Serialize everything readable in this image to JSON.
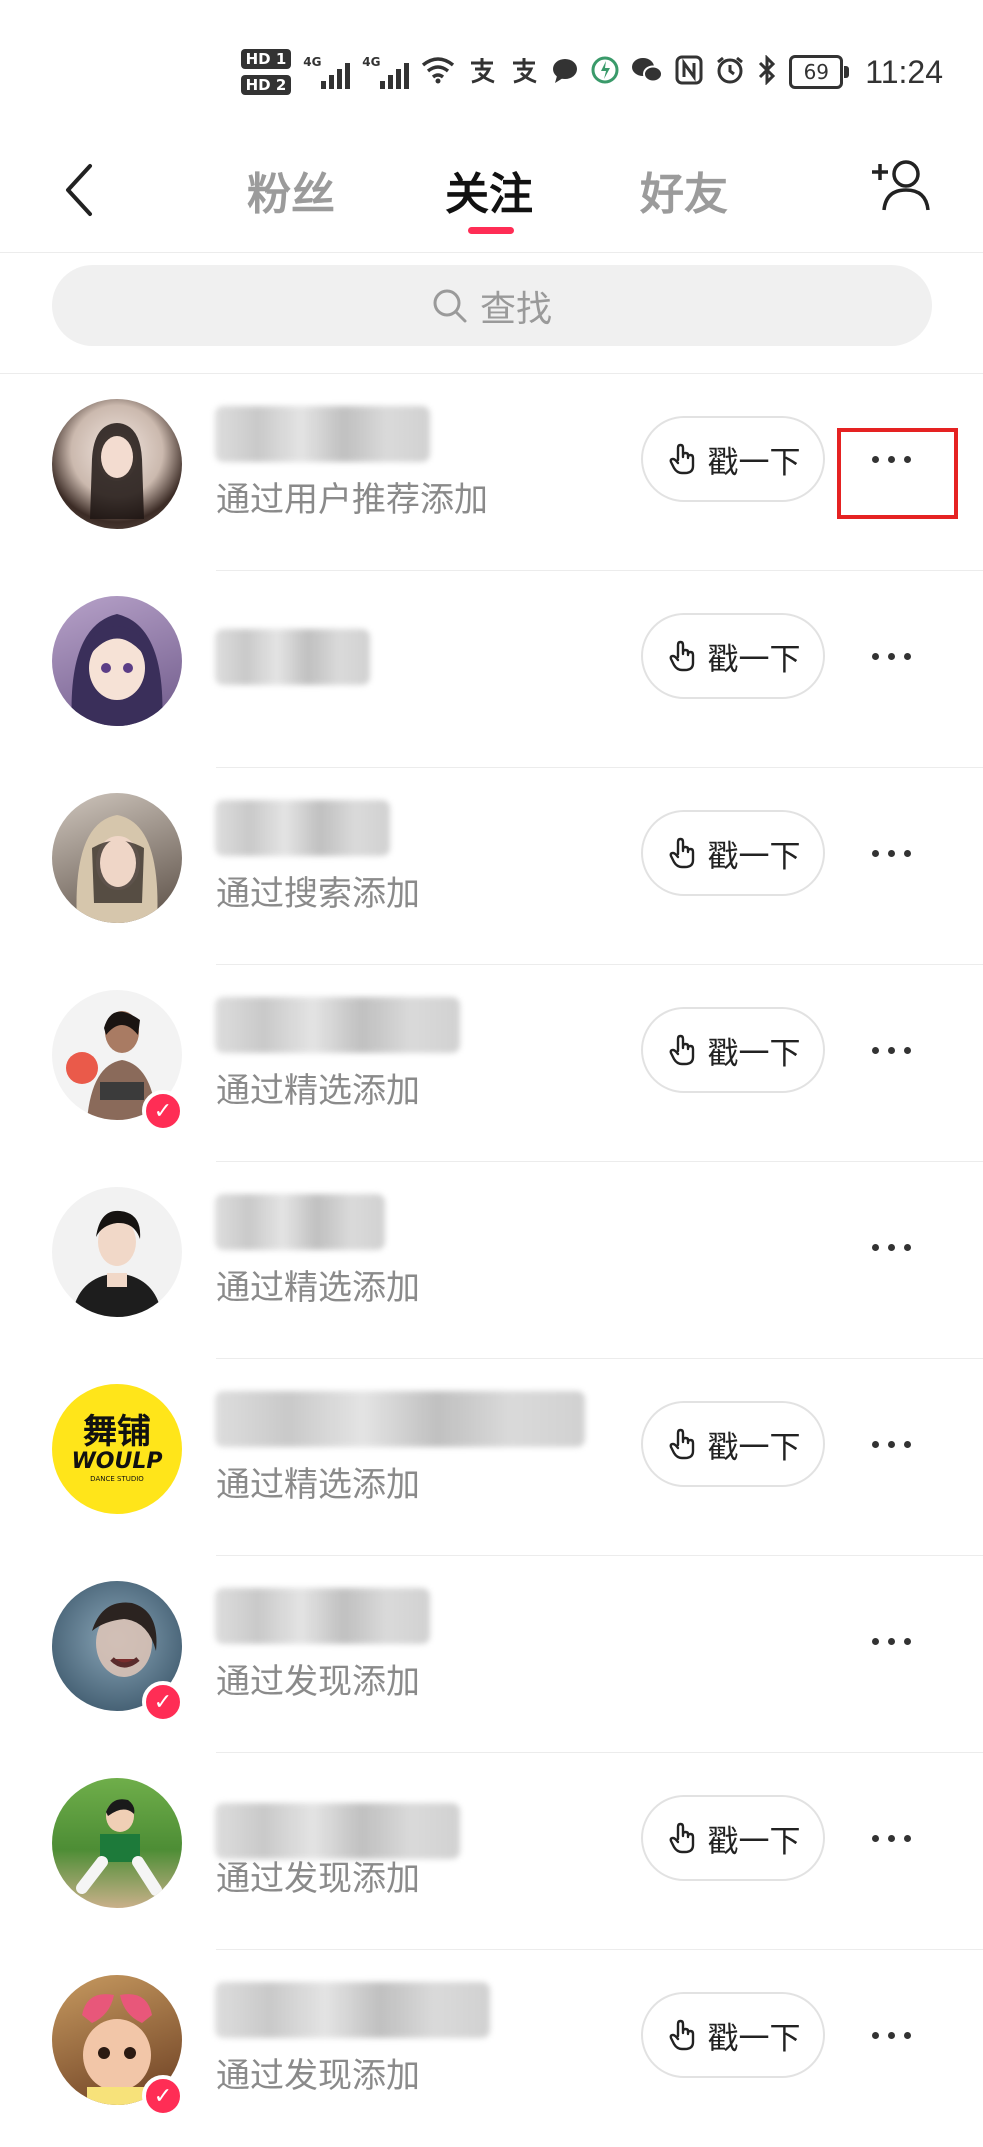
{
  "status_bar": {
    "time": "11:24",
    "battery": "69",
    "hd1": "HD 1",
    "hd2": "HD 2",
    "net1": "4G",
    "net2": "4G"
  },
  "nav": {
    "tabs": [
      {
        "label": "粉丝"
      },
      {
        "label": "关注"
      },
      {
        "label": "好友"
      }
    ],
    "active_tab": "关注"
  },
  "search": {
    "placeholder": "查找"
  },
  "poke_label": "戳一下",
  "list": [
    {
      "subtitle": "通过用户推荐添加",
      "has_poke": true,
      "verified": false
    },
    {
      "subtitle": "",
      "has_poke": true,
      "verified": false
    },
    {
      "subtitle": "通过搜索添加",
      "has_poke": true,
      "verified": false
    },
    {
      "subtitle": "通过精选添加",
      "has_poke": true,
      "verified": true
    },
    {
      "subtitle": "通过精选添加",
      "has_poke": false,
      "verified": false
    },
    {
      "subtitle": "通过精选添加",
      "has_poke": true,
      "verified": false,
      "logo_top": "舞铺",
      "logo_bottom": "WOULP",
      "logo_small": "DANCE STUDIO"
    },
    {
      "subtitle": "通过发现添加",
      "has_poke": false,
      "verified": true
    },
    {
      "subtitle": "通过发现添加",
      "has_poke": true,
      "verified": false
    },
    {
      "subtitle": "通过发现添加",
      "has_poke": true,
      "verified": true
    }
  ],
  "colors": {
    "accent": "#ff2d55",
    "highlight": "#e52222",
    "muted": "#8a8a8a"
  }
}
